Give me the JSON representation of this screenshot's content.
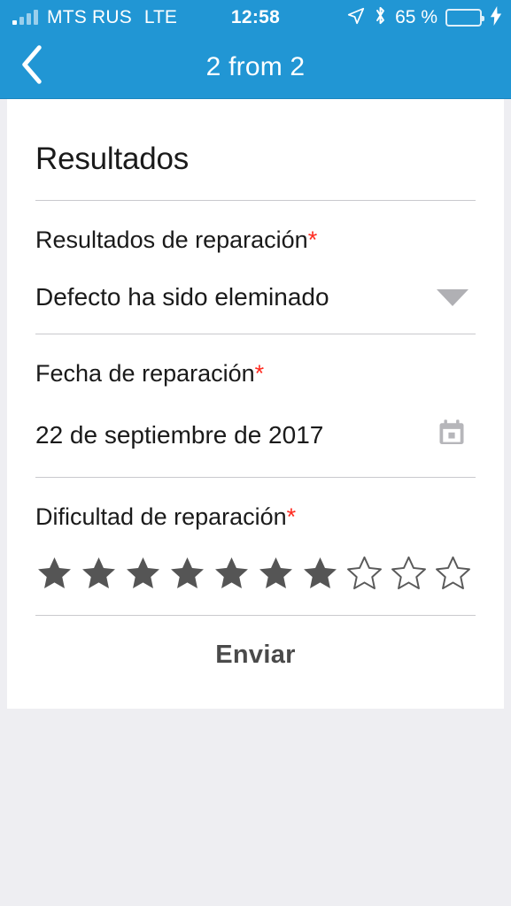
{
  "status_bar": {
    "carrier": "MTS RUS",
    "network": "LTE",
    "time": "12:58",
    "battery_percent": "65 %",
    "battery_level": 65,
    "icons": [
      "signal-bars-icon",
      "location-arrow-icon",
      "bluetooth-icon",
      "battery-icon",
      "charging-bolt-icon"
    ],
    "background_color": "#2196d4"
  },
  "nav_bar": {
    "back_icon": "chevron-left-icon",
    "title": "2 from 2",
    "background_color": "#2196d4"
  },
  "main": {
    "section_title": "Resultados",
    "fields": [
      {
        "label": "Resultados de reparación",
        "required_marker": "*",
        "value": "Defecto ha sido eleminado",
        "control": "dropdown",
        "control_icon": "chevron-down-icon"
      },
      {
        "label": "Fecha de reparación",
        "required_marker": "*",
        "value": "22 de septiembre de 2017",
        "control": "date-picker",
        "control_icon": "calendar-icon"
      },
      {
        "label": "Dificultad de reparación",
        "required_marker": "*",
        "control": "star-rating",
        "rating_value": 7,
        "rating_max": 10
      }
    ],
    "submit_label": "Enviar"
  },
  "colors": {
    "accent": "#2196d4",
    "required": "#ff2b20",
    "star_filled": "#555555",
    "star_empty": "#5a5a5a",
    "divider": "#c9c9cd",
    "page_background": "#eeeef2",
    "battery_green": "#4cd964"
  }
}
